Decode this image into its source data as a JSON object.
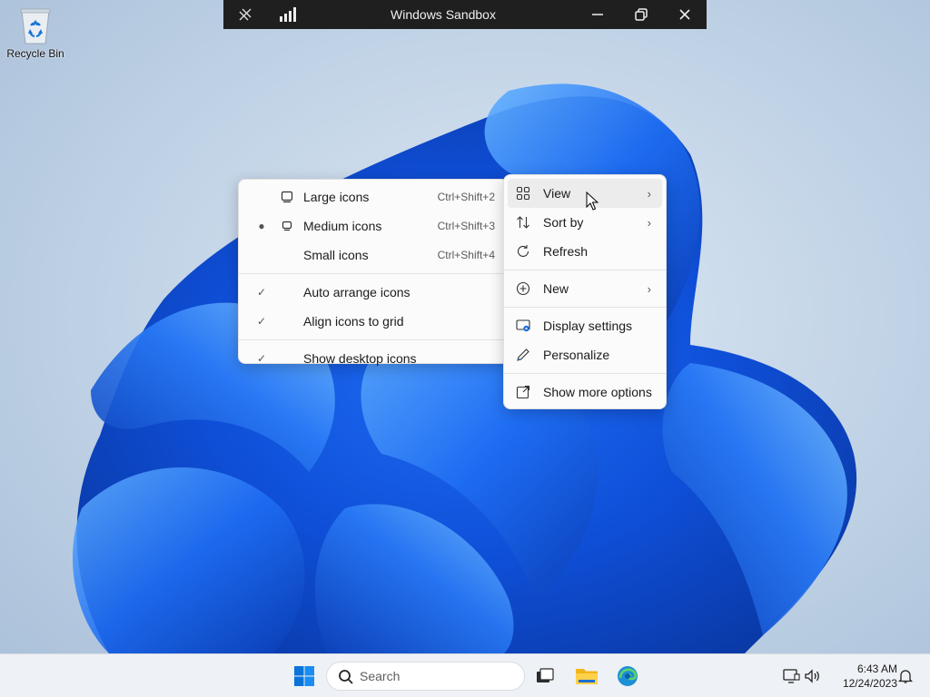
{
  "sandbox": {
    "title": "Windows Sandbox",
    "controls": [
      "ctrl-alt-del-icon",
      "signal-icon",
      "minimize-icon",
      "restore-icon",
      "close-icon"
    ]
  },
  "desktop": {
    "icons": [
      {
        "label": "Recycle Bin",
        "icon": "recycle-bin-icon"
      }
    ]
  },
  "context_menu": {
    "items": [
      {
        "label": "View",
        "icon": "grid-icon",
        "submenu": true,
        "hover": true
      },
      {
        "label": "Sort by",
        "icon": "sort-icon",
        "submenu": true
      },
      {
        "label": "Refresh",
        "icon": "refresh-icon"
      },
      {
        "label": "New",
        "icon": "plus-circle-icon",
        "submenu": true
      },
      {
        "label": "Display settings",
        "icon": "display-icon"
      },
      {
        "label": "Personalize",
        "icon": "pen-icon"
      },
      {
        "label": "Show more options",
        "icon": "external-icon"
      }
    ]
  },
  "view_submenu": {
    "items": [
      {
        "label": "Large icons",
        "shortcut": "Ctrl+Shift+2",
        "icon": "large-icon-icon"
      },
      {
        "label": "Medium icons",
        "shortcut": "Ctrl+Shift+3",
        "icon": "medium-icon-icon",
        "selected": true
      },
      {
        "label": "Small icons",
        "shortcut": "Ctrl+Shift+4"
      },
      {
        "label": "Auto arrange icons",
        "checked": true
      },
      {
        "label": "Align icons to grid",
        "checked": true
      },
      {
        "label": "Show desktop icons",
        "checked": true
      }
    ]
  },
  "taskbar": {
    "search_label": "Search",
    "apps": [
      "start-icon",
      "task-view-icon",
      "file-explorer-icon",
      "edge-icon"
    ],
    "clock_time": "6:43 AM",
    "clock_date": "12/24/2023"
  }
}
